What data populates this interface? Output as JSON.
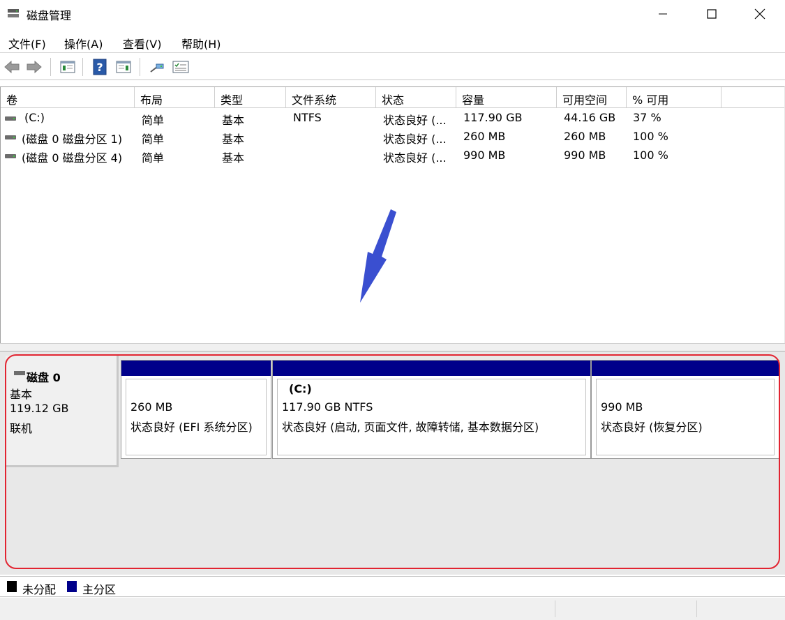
{
  "window": {
    "title": "磁盘管理"
  },
  "menu": [
    "文件(F)",
    "操作(A)",
    "查看(V)",
    "帮助(H)"
  ],
  "toolbar": {
    "icons": [
      "back-icon",
      "forward-icon",
      "console-tree-icon",
      "help-icon",
      "action-pane-icon",
      "connect-icon",
      "properties-icon"
    ]
  },
  "volume_table": {
    "columns": [
      "卷",
      "布局",
      "类型",
      "文件系统",
      "状态",
      "容量",
      "可用空间",
      "% 可用"
    ],
    "rows": [
      [
        "(C:)",
        "简单",
        "基本",
        "NTFS",
        "状态良好 (...",
        "117.90 GB",
        "44.16 GB",
        "37 %"
      ],
      [
        "(磁盘 0 磁盘分区 1)",
        "简单",
        "基本",
        "",
        "状态良好 (...",
        "260 MB",
        "260 MB",
        "100 %"
      ],
      [
        "(磁盘 0 磁盘分区 4)",
        "简单",
        "基本",
        "",
        "状态良好 (...",
        "990 MB",
        "990 MB",
        "100 %"
      ]
    ]
  },
  "disk": {
    "name": "磁盘 0",
    "type": "基本",
    "size": "119.12 GB",
    "status": "联机",
    "partitions": [
      {
        "label": "",
        "line1": "260 MB",
        "line2": "状态良好 (EFI 系统分区)"
      },
      {
        "label": "(C:)",
        "line1": "117.90 GB NTFS",
        "line2": "状态良好 (启动, 页面文件, 故障转储, 基本数据分区)"
      },
      {
        "label": "",
        "line1": "990 MB",
        "line2": "状态良好 (恢复分区)"
      }
    ]
  },
  "legend": [
    {
      "label": "未分配",
      "color": "#000000"
    },
    {
      "label": "主分区",
      "color": "#00008a"
    }
  ],
  "colors": {
    "partition_header": "#00008a",
    "highlight": "#e22431",
    "annotation_arrow": "#3a4fd0"
  }
}
